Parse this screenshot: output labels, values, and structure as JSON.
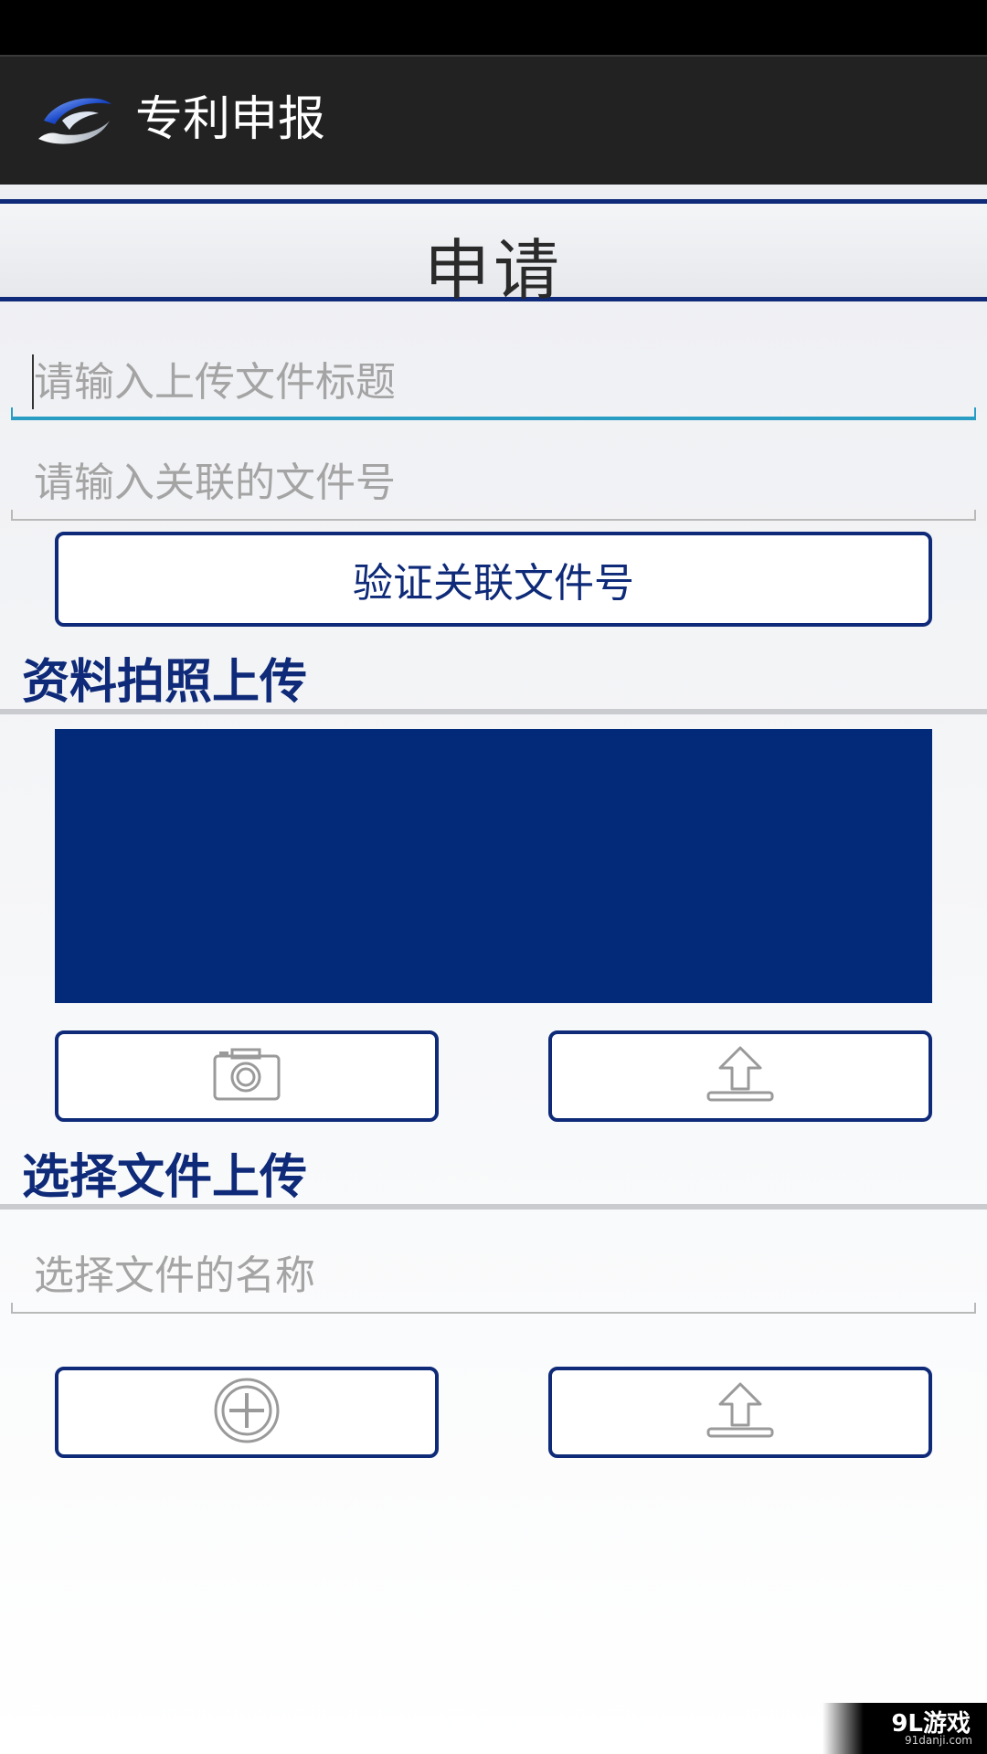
{
  "app": {
    "title": "专利申报",
    "logo_icon": "app-logo-swoosh"
  },
  "page": {
    "heading": "申请"
  },
  "form": {
    "upload_title": {
      "placeholder": "请输入上传文件标题",
      "value": ""
    },
    "related_file_no": {
      "placeholder": "请输入关联的文件号",
      "value": ""
    },
    "verify_button_label": "验证关联文件号"
  },
  "photo_section": {
    "title": "资料拍照上传",
    "preview_color": "#022a79",
    "camera_icon": "camera-icon",
    "upload_icon": "upload-icon"
  },
  "file_section": {
    "title": "选择文件上传",
    "file_name": {
      "placeholder": "选择文件的名称",
      "value": ""
    },
    "add_icon": "add-circle-icon",
    "upload_icon": "upload-icon"
  },
  "colors": {
    "accent": "#0e2a78",
    "focus": "#2a9dc4",
    "action_bar": "#222222"
  },
  "watermark": {
    "main": "9L游戏",
    "sub": "91danji.com"
  }
}
